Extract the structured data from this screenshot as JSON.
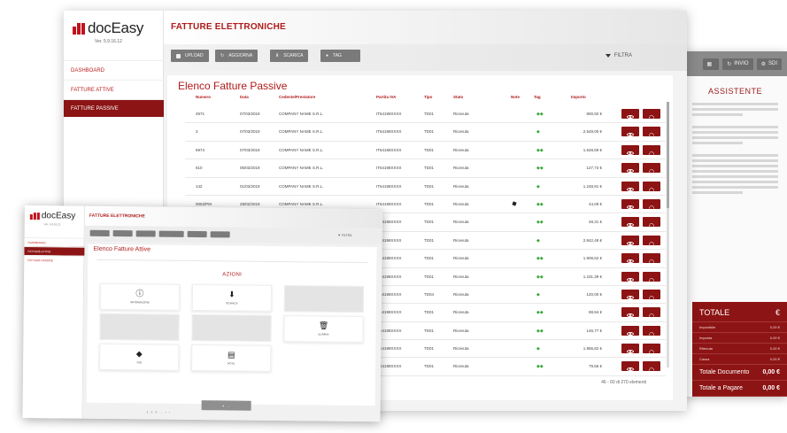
{
  "app": {
    "name": "docEasy",
    "version": "Ver. 5.9.16.12"
  },
  "colors": {
    "brand": "#8c1414",
    "accent": "#b01a1a",
    "tag": "#3aa83a"
  },
  "sidebar": {
    "items": [
      {
        "label": "DASHBOARD",
        "active": false
      },
      {
        "label": "FATTURE ATTIVE",
        "active": false
      },
      {
        "label": "FATTURE PASSIVE",
        "active": true
      }
    ]
  },
  "header": {
    "title": "FATTURE ELETTRONICHE"
  },
  "toolbar": {
    "buttons": [
      {
        "label": "UPLOAD",
        "icon": "user-icon"
      },
      {
        "label": "AGGIORNA",
        "icon": "refresh-icon"
      },
      {
        "label": "SCARICA",
        "icon": "download-icon"
      },
      {
        "label": "TAG",
        "icon": "tag-icon"
      }
    ],
    "filter_label": "FILTRA"
  },
  "table": {
    "title": "Elenco Fatture Passive",
    "columns": [
      "Numero",
      "Data",
      "Cedente/Prestatore",
      "Partita IVA",
      "Tipo",
      "Stato",
      "Note",
      "Tag",
      "Importo"
    ],
    "rows": [
      {
        "numero": "4971",
        "data": "07/03/2019",
        "cedente": "COMPANY NAME S.R.L.",
        "piva": "IT64198XXXX",
        "tipo": "TD01",
        "stato": "Ricevuta",
        "note": "",
        "importo": "800,92 €"
      },
      {
        "numero": "3",
        "data": "07/03/2019",
        "cedente": "COMPANY NAME S.R.L.",
        "piva": "IT64198XXXX",
        "tipo": "TD01",
        "stato": "Ricevuta",
        "note": "",
        "importo": "2.549,00 €"
      },
      {
        "numero": "6974",
        "data": "07/03/2019",
        "cedente": "COMPANY NAME S.R.L.",
        "piva": "IT64198XXXX",
        "tipo": "TD01",
        "stato": "Ricevuta",
        "note": "",
        "importo": "1.548,59 €"
      },
      {
        "numero": "610",
        "data": "05/03/2019",
        "cedente": "COMPANY NAME S.R.L.",
        "piva": "IT64198XXXX",
        "tipo": "TD01",
        "stato": "Ricevuta",
        "note": "",
        "importo": "127,73 €"
      },
      {
        "numero": "142",
        "data": "01/03/2019",
        "cedente": "COMPANY NAME S.R.L.",
        "piva": "IT64198XXXX",
        "tipo": "TD01",
        "stato": "Ricevuta",
        "note": "",
        "importo": "1.248,91 €"
      },
      {
        "numero": "0053/PM",
        "data": "28/02/2019",
        "cedente": "COMPANY NAME S.R.L.",
        "piva": "IT64198XXXX",
        "tipo": "TD01",
        "stato": "Ricevuta",
        "note": "note",
        "importo": "44,09 €"
      },
      {
        "numero": "",
        "data": "",
        "cedente": "",
        "piva": "IT64198XXXX",
        "tipo": "TD01",
        "stato": "Ricevuta",
        "note": "",
        "importo": "48,31 €"
      },
      {
        "numero": "",
        "data": "",
        "cedente": "",
        "piva": "IT64198XXXX",
        "tipo": "TD01",
        "stato": "Ricevuta",
        "note": "",
        "importo": "2.842,48 €"
      },
      {
        "numero": "",
        "data": "",
        "cedente": "",
        "piva": "IT64198XXXX",
        "tipo": "TD01",
        "stato": "Ricevuta",
        "note": "",
        "importo": "1.909,52 €"
      },
      {
        "numero": "",
        "data": "",
        "cedente": "",
        "piva": "IT64198XXXX",
        "tipo": "TD01",
        "stato": "Ricevuta",
        "note": "",
        "importo": "1.231,39 €"
      },
      {
        "numero": "",
        "data": "",
        "cedente": "",
        "piva": "IT64198XXXX",
        "tipo": "TD04",
        "stato": "Ricevuta",
        "note": "",
        "importo": "120,00 €"
      },
      {
        "numero": "",
        "data": "",
        "cedente": "",
        "piva": "IT64198XXXX",
        "tipo": "TD01",
        "stato": "Ricevuta",
        "note": "",
        "importo": "88,94 €"
      },
      {
        "numero": "",
        "data": "",
        "cedente": "",
        "piva": "IT64198XXXX",
        "tipo": "TD01",
        "stato": "Ricevuta",
        "note": "",
        "importo": "146,77 €"
      },
      {
        "numero": "",
        "data": "",
        "cedente": "",
        "piva": "IT64198XXXX",
        "tipo": "TD01",
        "stato": "Ricevuta",
        "note": "",
        "importo": "1.956,82 €"
      },
      {
        "numero": "",
        "data": "",
        "cedente": "",
        "piva": "IT64198XXXX",
        "tipo": "TD01",
        "stato": "Ricevuta",
        "note": "",
        "importo": "79,56 €"
      }
    ],
    "pagination": "46 - 60 di 270 elementi"
  },
  "assistant": {
    "buttons": [
      {
        "label": "",
        "icon": "grid-icon"
      },
      {
        "label": "INVIO",
        "icon": "refresh-icon"
      },
      {
        "label": "SDI",
        "icon": "gear-icon"
      }
    ],
    "title": "ASSISTENTE",
    "totale": {
      "title": "TOTALE",
      "currency": "€",
      "rows": [
        {
          "label": "Imponibile",
          "value": "0,00 €"
        },
        {
          "label": "Imposta",
          "value": "0,00 €"
        },
        {
          "label": "Ritenuta",
          "value": "0,00 €"
        },
        {
          "label": "Cassa",
          "value": "0,00 €"
        }
      ],
      "documento_label": "Totale Documento",
      "documento_value": "0,00 €",
      "pagare_label": "Totale a Pagare",
      "pagare_value": "0,00 €"
    }
  },
  "front": {
    "app_name": "docEasy",
    "header_title": "FATTURE ELETTRONICHE",
    "filter_label": "FILTRA",
    "table_title": "Elenco Fatture Attive",
    "azioni_title": "AZIONI",
    "tiles": [
      {
        "label": "INFORMAZIONI",
        "icon": "info-icon",
        "disabled": false
      },
      {
        "label": "SCARICA",
        "icon": "download-icon",
        "disabled": false
      },
      {
        "label": "",
        "icon": "",
        "disabled": true
      },
      {
        "label": "",
        "icon": "",
        "disabled": true
      },
      {
        "label": "",
        "icon": "",
        "disabled": true
      },
      {
        "label": "ELIMINA",
        "icon": "trash-icon",
        "disabled": false
      },
      {
        "label": "TAG",
        "icon": "tag-icon",
        "disabled": false
      },
      {
        "label": "NOTE",
        "icon": "note-icon",
        "disabled": false
      }
    ]
  }
}
